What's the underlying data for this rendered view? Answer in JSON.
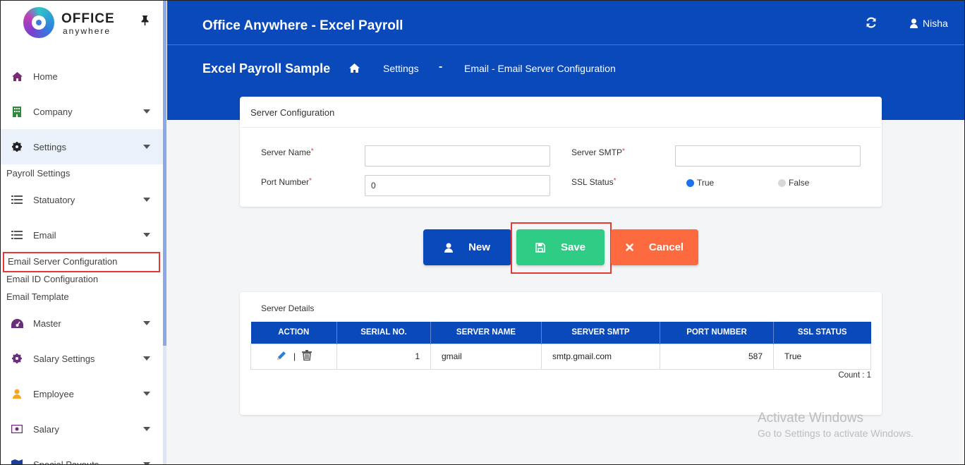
{
  "app": {
    "logo_text": "OFFICE",
    "logo_sub": "anywhere",
    "title": "Office Anywhere - Excel Payroll",
    "user": "Nisha"
  },
  "breadcrumb": {
    "page_title": "Excel Payroll Sample",
    "item1": "Settings",
    "separator": "-",
    "item2": "Email - Email Server Configuration"
  },
  "sidebar": {
    "items": [
      {
        "label": "Home",
        "icon": "home-icon"
      },
      {
        "label": "Company",
        "icon": "building-icon"
      },
      {
        "label": "Settings",
        "icon": "gear-icon"
      },
      {
        "label": "Statuatory",
        "icon": "list-icon"
      },
      {
        "label": "Email",
        "icon": "list-icon"
      },
      {
        "label": "Master",
        "icon": "dashboard-icon"
      },
      {
        "label": "Salary Settings",
        "icon": "gear-icon"
      },
      {
        "label": "Employee",
        "icon": "user-icon"
      },
      {
        "label": "Salary",
        "icon": "money-icon"
      },
      {
        "label": "Special Payouts",
        "icon": "map-icon"
      }
    ],
    "sub_payroll_settings": "Payroll Settings",
    "sub_email": [
      "Email Server Configuration",
      "Email ID Configuration",
      "Email Template"
    ]
  },
  "config": {
    "header": "Server Configuration",
    "server_name_label": "Server Name",
    "server_name_value": "",
    "port_label": "Port Number",
    "port_value": "0",
    "smtp_label": "Server SMTP",
    "smtp_value": "",
    "ssl_label": "SSL Status",
    "ssl_true": "True",
    "ssl_false": "False",
    "required_mark": "*"
  },
  "buttons": {
    "new": "New",
    "save": "Save",
    "cancel": "Cancel"
  },
  "details": {
    "header": "Server Details",
    "columns": [
      "ACTION",
      "SERIAL NO.",
      "SERVER NAME",
      "SERVER SMTP",
      "PORT NUMBER",
      "SSL STATUS"
    ],
    "rows": [
      {
        "serial": "1",
        "server_name": "gmail",
        "smtp": "smtp.gmail.com",
        "port": "587",
        "ssl": "True"
      }
    ],
    "action_sep": "|",
    "count": "Count : 1"
  },
  "watermark": {
    "line1": "Activate Windows",
    "line2": "Go to Settings to activate Windows."
  },
  "colors": {
    "primary": "#0a49b9",
    "save": "#2fcc85",
    "cancel": "#fd6a3f",
    "highlight": "#e53935"
  }
}
